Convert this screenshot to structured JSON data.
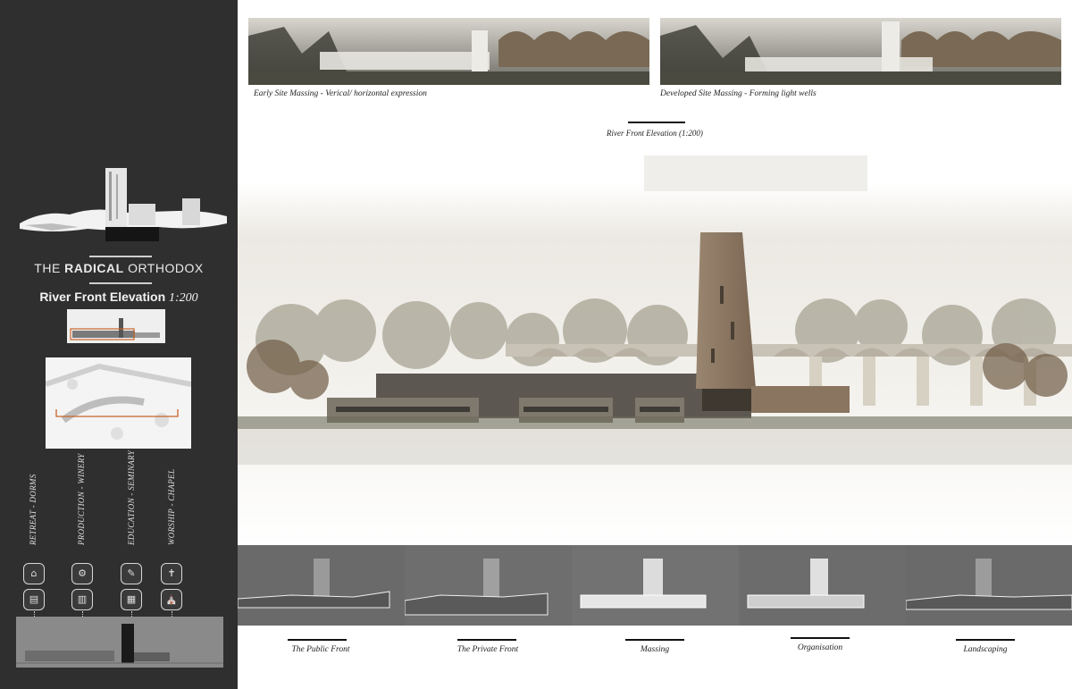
{
  "sidebar": {
    "title_prefix": "THE",
    "title_bold": "RADICAL",
    "title_suffix": "ORTHODOX",
    "subtitle": "River Front Elevation",
    "subtitle_scale": "1:200",
    "programs": [
      {
        "label": "RETREAT - DORMS",
        "icon1": "retreat-icon",
        "icon2": "dorms-icon"
      },
      {
        "label": "PRODUCTION - WINERY",
        "icon1": "production-icon",
        "icon2": "winery-icon"
      },
      {
        "label": "EDUCATION - SEMINARY",
        "icon1": "education-icon",
        "icon2": "seminary-icon"
      },
      {
        "label": "WORSHIP - CHAPEL",
        "icon1": "worship-icon",
        "icon2": "chapel-icon"
      }
    ]
  },
  "top_photos": [
    {
      "caption": "Early Site Massing - Verical/ horizontal expression"
    },
    {
      "caption": "Developed Site Massing - Forming light wells"
    }
  ],
  "elevation": {
    "caption": "River Front Elevation (1:200)"
  },
  "strips": [
    {
      "label": "The Public Front"
    },
    {
      "label": "The Private Front"
    },
    {
      "label": "Massing"
    },
    {
      "label": "Organisation"
    },
    {
      "label": "Landscaping"
    }
  ],
  "colors": {
    "sidebar_bg": "#2f2f2f",
    "accent_orange": "#c8642a",
    "tower": "#8a7560"
  }
}
